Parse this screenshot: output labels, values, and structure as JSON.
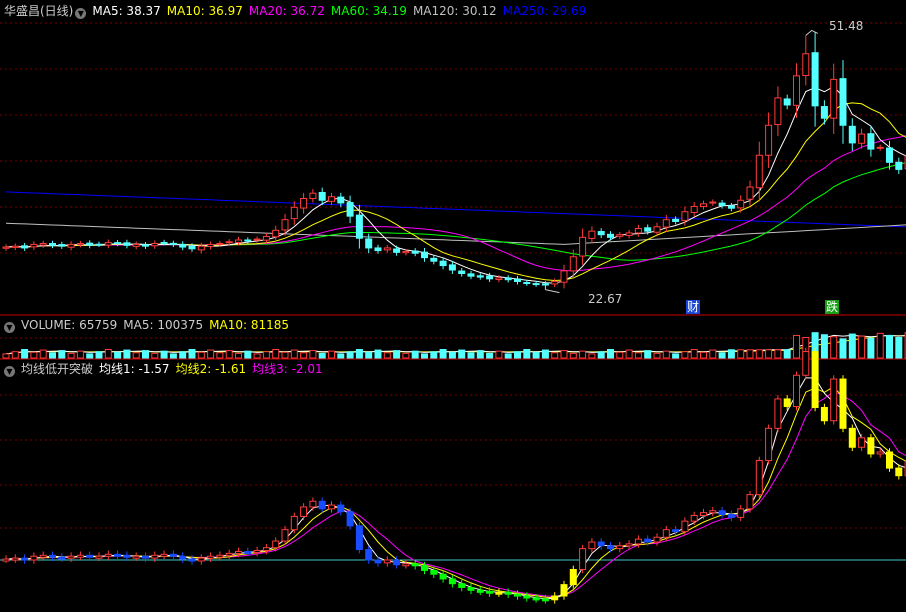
{
  "price_panel": {
    "title": "华盛昌(日线)",
    "ma5": "MA5: 38.37",
    "ma10": "MA10: 36.97",
    "ma20": "MA20: 36.72",
    "ma60": "MA60: 34.19",
    "ma120": "MA120: 30.12",
    "ma250": "MA250: 29.69",
    "high_label": "51.48",
    "low_label": "22.67",
    "tag_cai": "财",
    "tag_die": "跌"
  },
  "volume_panel": {
    "volume": "VOLUME: 65759",
    "ma5": "MA5: 100375",
    "ma10": "MA10: 81185"
  },
  "indicator_panel": {
    "name": "均线低开突破",
    "line1": "均线1: -1.57",
    "line2": "均线2: -1.61",
    "line3": "均线3: -2.01"
  },
  "colors": {
    "up": "#ff3b3b",
    "down": "#54ffff",
    "ma5": "#ffffff",
    "ma10": "#ffff00",
    "ma20": "#ff00ff",
    "ma60": "#00ff00",
    "ma120": "#c0c0c0",
    "ma250": "#0000ff",
    "grid": "#7a0000",
    "separator": "#c80000"
  },
  "chart_data": {
    "type": "candlestick",
    "title": "华盛昌(日线)",
    "price_range": [
      21.5,
      53
    ],
    "close_series": [
      27.5,
      27.6,
      27.4,
      27.8,
      27.9,
      27.7,
      27.6,
      27.8,
      27.9,
      27.7,
      27.8,
      28.0,
      27.9,
      27.7,
      27.8,
      27.6,
      27.9,
      28.0,
      27.8,
      27.5,
      27.3,
      27.6,
      27.8,
      27.9,
      28.1,
      28.3,
      28.2,
      28.4,
      28.7,
      29.4,
      30.6,
      32.0,
      33.0,
      33.6,
      32.8,
      33.2,
      32.5,
      31.0,
      28.5,
      27.4,
      27.1,
      27.4,
      26.9,
      27.0,
      26.8,
      26.3,
      25.9,
      25.4,
      24.9,
      24.5,
      24.2,
      24.1,
      23.9,
      24.0,
      23.8,
      23.6,
      23.4,
      23.3,
      23.2,
      23.6,
      24.8,
      26.4,
      28.6,
      29.3,
      28.9,
      28.6,
      28.9,
      29.1,
      29.6,
      29.3,
      29.8,
      30.6,
      30.4,
      31.5,
      32.1,
      32.4,
      32.6,
      32.2,
      31.9,
      32.8,
      34.3,
      37.9,
      41.3,
      44.4,
      43.6,
      46.9,
      49.4,
      43.5,
      42.1,
      46.5,
      41.3,
      39.3,
      40.3,
      38.6,
      38.8,
      37.1,
      36.3,
      37.8,
      35.7
    ],
    "high": 51.48,
    "low": 22.67,
    "volume": 65759,
    "volume_ma5": 100375,
    "volume_ma10": 81185,
    "ma": {
      "MA5": 38.37,
      "MA10": 36.97,
      "MA20": 36.72,
      "MA60": 34.19,
      "MA120": 30.12,
      "MA250": 29.69
    },
    "indicator": {
      "name": "均线低开突破",
      "均线1": -1.57,
      "均线2": -1.61,
      "均线3": -2.01
    }
  }
}
